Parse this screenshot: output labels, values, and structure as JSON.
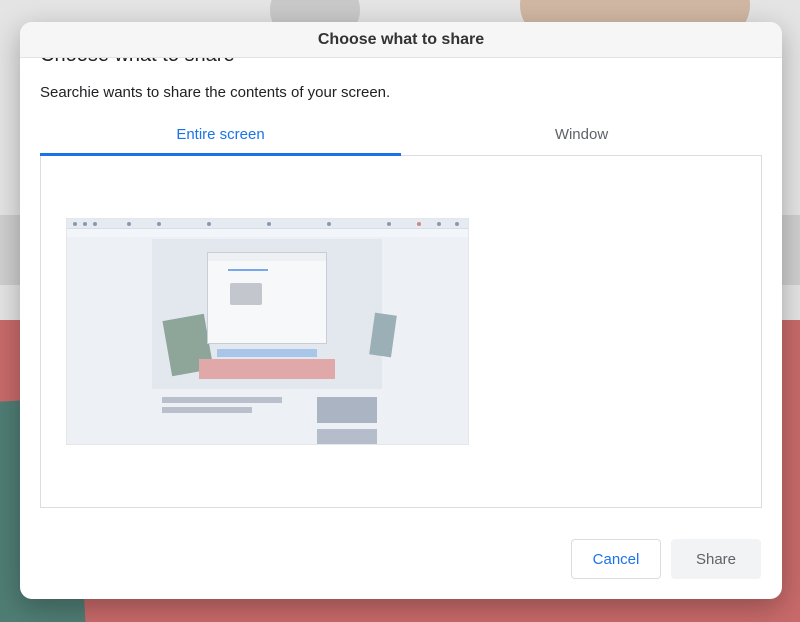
{
  "dialog": {
    "title": "Choose what to share",
    "heading": "Choose what to share",
    "description": "Searchie wants to share the contents of your screen.",
    "tabs": [
      {
        "label": "Entire screen",
        "active": true
      },
      {
        "label": "Window",
        "active": false
      }
    ],
    "buttons": {
      "cancel": "Cancel",
      "share": "Share"
    }
  },
  "colors": {
    "accent": "#1a73e8",
    "disabled_button_bg": "#f1f3f4"
  }
}
